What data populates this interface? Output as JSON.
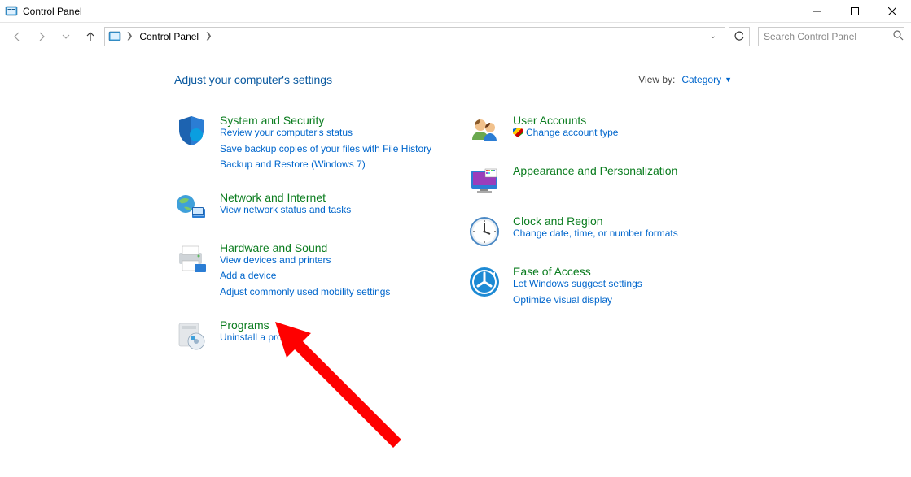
{
  "window": {
    "title": "Control Panel"
  },
  "breadcrumb": {
    "root": "Control Panel"
  },
  "search": {
    "placeholder": "Search Control Panel"
  },
  "header": {
    "heading": "Adjust your computer's settings",
    "viewby_label": "View by:",
    "viewby_value": "Category"
  },
  "left_col": {
    "system_security": {
      "title": "System and Security",
      "link1": "Review your computer's status",
      "link2": "Save backup copies of your files with File History",
      "link3": "Backup and Restore (Windows 7)"
    },
    "network": {
      "title": "Network and Internet",
      "link1": "View network status and tasks"
    },
    "hardware": {
      "title": "Hardware and Sound",
      "link1": "View devices and printers",
      "link2": "Add a device",
      "link3": "Adjust commonly used mobility settings"
    },
    "programs": {
      "title": "Programs",
      "link1": "Uninstall a program"
    }
  },
  "right_col": {
    "accounts": {
      "title": "User Accounts",
      "link1": "Change account type"
    },
    "appearance": {
      "title": "Appearance and Personalization"
    },
    "clock": {
      "title": "Clock and Region",
      "link1": "Change date, time, or number formats"
    },
    "ease": {
      "title": "Ease of Access",
      "link1": "Let Windows suggest settings",
      "link2": "Optimize visual display"
    }
  }
}
